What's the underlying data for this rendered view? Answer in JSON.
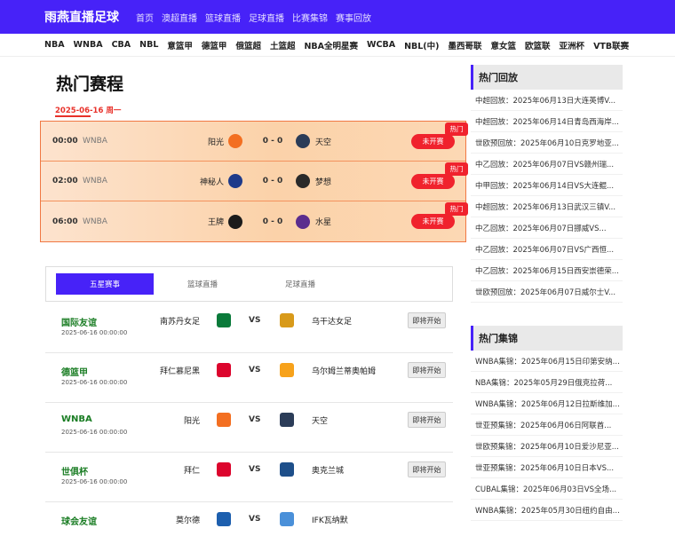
{
  "header": {
    "logo": "雨燕直播足球",
    "nav": [
      "首页",
      "澳超直播",
      "篮球直播",
      "足球直播",
      "比赛集锦",
      "赛事回放"
    ]
  },
  "categories": [
    "NBA",
    "WNBA",
    "CBA",
    "NBL",
    "意篮甲",
    "德篮甲",
    "俄篮超",
    "土篮超",
    "NBA全明星赛",
    "WCBA",
    "NBL(中)",
    "墨西哥联",
    "意女篮",
    "欧篮联",
    "亚洲杯",
    "VTB联赛"
  ],
  "hot": {
    "title": "热门赛程",
    "date": "2025-06-16 周一",
    "rows": [
      {
        "time": "00:00",
        "league": "WNBA",
        "home": "阳光",
        "score": "0 - 0",
        "away": "天空",
        "button": "未开赛",
        "tag": "热门",
        "home_color": "#f36f21",
        "away_color": "#2b3c58"
      },
      {
        "time": "02:00",
        "league": "WNBA",
        "home": "神秘人",
        "score": "0 - 0",
        "away": "梦想",
        "button": "未开赛",
        "tag": "热门",
        "home_color": "#1e3a8a",
        "away_color": "#2a2a2a"
      },
      {
        "time": "06:00",
        "league": "WNBA",
        "home": "王牌",
        "score": "0 - 0",
        "away": "水星",
        "button": "未开赛",
        "tag": "热门",
        "home_color": "#1b1b1b",
        "away_color": "#5b2d8e"
      }
    ]
  },
  "tabs": [
    "五星赛事",
    "篮球直播",
    "足球直播"
  ],
  "matches": [
    {
      "league": "国际友谊",
      "time": "2025-06-16 00:00:00",
      "home": "南苏丹女足",
      "vs": "VS",
      "away": "乌干达女足",
      "button": "即将开始",
      "home_color": "#0a7a3a",
      "away_color": "#d89a1a"
    },
    {
      "league": "德篮甲",
      "time": "2025-06-16 00:00:00",
      "home": "拜仁慕尼黑",
      "vs": "VS",
      "away": "乌尔姆兰蒂奥帕姆",
      "button": "即将开始",
      "home_color": "#dc052d",
      "away_color": "#f7a21b"
    },
    {
      "league": "WNBA",
      "time": "2025-06-16 00:00:00",
      "home": "阳光",
      "vs": "VS",
      "away": "天空",
      "button": "即将开始",
      "home_color": "#f36f21",
      "away_color": "#2b3c58"
    },
    {
      "league": "世俱杯",
      "time": "2025-06-16 00:00:00",
      "home": "拜仁",
      "vs": "VS",
      "away": "奥克兰城",
      "button": "即将开始",
      "home_color": "#dc052d",
      "away_color": "#1e4f8a"
    },
    {
      "league": "球会友谊",
      "time": "",
      "home": "莫尔德",
      "vs": "VS",
      "away": "IFK瓦纳默",
      "button": "",
      "home_color": "#1d5fae",
      "away_color": "#4a90d9"
    }
  ],
  "sidebar": {
    "replay_title": "热门回放",
    "replays": [
      "中超回放：2025年06月13日大连英博V...",
      "中超回放：2025年06月14日青岛西海岸...",
      "世欧预回放：2025年06月10日克罗地亚...",
      "中乙回放：2025年06月07日VS赣州瑞...",
      "中甲回放：2025年06月14日VS大连鲲...",
      "中超回放：2025年06月13日武汉三镇V...",
      "中乙回放：2025年06月07日挪威VS...",
      "中乙回放：2025年06月07日VS广西恒...",
      "中乙回放：2025年06月15日西安崇德荣...",
      "世欧预回放：2025年06月07日威尔士V..."
    ],
    "highlights_title": "热门集锦",
    "highlights": [
      "WNBA集锦：2025年06月15日印第安纳...",
      "NBA集锦：2025年05月29日俄克拉荷...",
      "WNBA集锦：2025年06月12日拉斯维加...",
      "世亚预集锦：2025年06月06日阿联酋...",
      "世欧预集锦：2025年06月10日爱沙尼亚...",
      "世亚预集锦：2025年06月10日日本VS...",
      "CUBAL集锦：2025年06月03日VS全场...",
      "WNBA集锦：2025年05月30日纽约自由..."
    ]
  }
}
